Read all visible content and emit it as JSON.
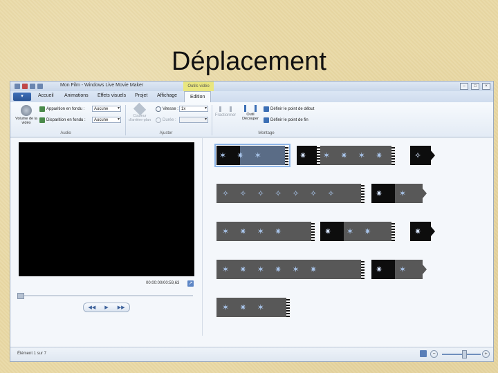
{
  "slide": {
    "title": "Déplacement"
  },
  "window": {
    "title": "Mon Film - Windows Live Movie Maker",
    "context_tab": "Outils vidéo",
    "controls": [
      "–",
      "□",
      "×"
    ]
  },
  "tabs": {
    "file": "▾",
    "items": [
      "Accueil",
      "Animations",
      "Effets visuels",
      "Projet",
      "Affichage"
    ],
    "active": "Edition"
  },
  "ribbon": {
    "audio": {
      "volume_label": "Volume de la vidéo",
      "fade_in_label": "Apparition en fondu :",
      "fade_in_value": "Aucune",
      "fade_out_label": "Disparition en fondu :",
      "fade_out_value": "Aucune",
      "group_label": "Audio"
    },
    "adjust": {
      "bg_color_label": "Couleur d'arrière-plan",
      "speed_label": "Vitesse :",
      "speed_value": "1x",
      "duration_label": "Durée :",
      "duration_value": "",
      "group_label": "Ajuster"
    },
    "edit": {
      "split_label": "Fractionner",
      "trim_label": "Outil Découper",
      "start_label": "Définir le point de début",
      "end_label": "Définir le point de fin",
      "group_label": "Montage"
    }
  },
  "player": {
    "timecode": "00:00:00/00:59,63",
    "controls": [
      "◀◀",
      "▶",
      "▶▶"
    ]
  },
  "status": {
    "text": "Élément 1 sur 7"
  },
  "colors": {
    "selection": "#8fb6e8",
    "accent": "#2a5494",
    "slide_bg": "#e9d9a6"
  }
}
